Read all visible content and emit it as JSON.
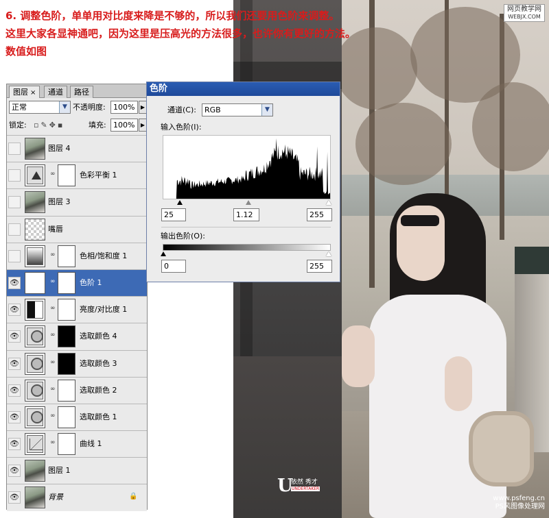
{
  "intro": {
    "line1": "6. 调整色阶，单单用对比度来降是不够的，所以我们还要用色阶来调整。",
    "line2": "这里大家各显神通吧，因为这里是压高光的方法很多，也许你有更好的方法。",
    "line3": "数值如图"
  },
  "site_tag": {
    "line1": "网页教学网",
    "line2": "WEBJX.COM"
  },
  "layers_panel": {
    "tabs": [
      "图层",
      "通道",
      "路径"
    ],
    "tab_close_glyph": "×",
    "blend_mode": "正常",
    "opacity_label": "不透明度:",
    "opacity_value": "100%",
    "lock_label": "锁定:",
    "fill_label": "填充:",
    "fill_value": "100%",
    "layers": [
      {
        "name": "图层 4",
        "kind": "pixel",
        "visible": false,
        "selected": false
      },
      {
        "name": "色彩平衡 1",
        "kind": "adjust",
        "visible": false,
        "selected": false
      },
      {
        "name": "图层 3",
        "kind": "pixel",
        "visible": false,
        "selected": false
      },
      {
        "name": "嘴唇",
        "kind": "pixel",
        "visible": false,
        "selected": false
      },
      {
        "name": "色相/饱和度 1",
        "kind": "adjust",
        "visible": false,
        "selected": false
      },
      {
        "name": "色阶 1",
        "kind": "adjust",
        "visible": true,
        "selected": true
      },
      {
        "name": "亮度/对比度 1",
        "kind": "adjust",
        "visible": true,
        "selected": false
      },
      {
        "name": "选取颜色 4",
        "kind": "adjust",
        "visible": true,
        "selected": false
      },
      {
        "name": "选取颜色 3",
        "kind": "adjust",
        "visible": true,
        "selected": false
      },
      {
        "name": "选取颜色 2",
        "kind": "adjust",
        "visible": true,
        "selected": false
      },
      {
        "name": "选取颜色 1",
        "kind": "adjust",
        "visible": true,
        "selected": false
      },
      {
        "name": "曲线 1",
        "kind": "adjust",
        "visible": true,
        "selected": false
      },
      {
        "name": "图层 1",
        "kind": "pixel",
        "visible": true,
        "selected": false
      },
      {
        "name": "背景",
        "kind": "pixel",
        "visible": true,
        "selected": false
      }
    ]
  },
  "levels_dialog": {
    "title": "色阶",
    "channel_label": "通道(C):",
    "channel_value": "RGB",
    "input_label": "输入色阶(I):",
    "input_black": "25",
    "input_gamma": "1.12",
    "input_white": "255",
    "output_label": "输出色阶(O):",
    "output_black": "0",
    "output_white": "255"
  },
  "watermark": {
    "logo_letter": "U",
    "text": "依然 秀才",
    "sub": "UNDERTAKER",
    "site1": "www.psfeng.cn",
    "site2": "PS风图像处理网"
  },
  "colors": {
    "intro_text": "#d81c1c",
    "selected_layer": "#3d6ab5",
    "dialog_title": "#2a5cb3"
  }
}
